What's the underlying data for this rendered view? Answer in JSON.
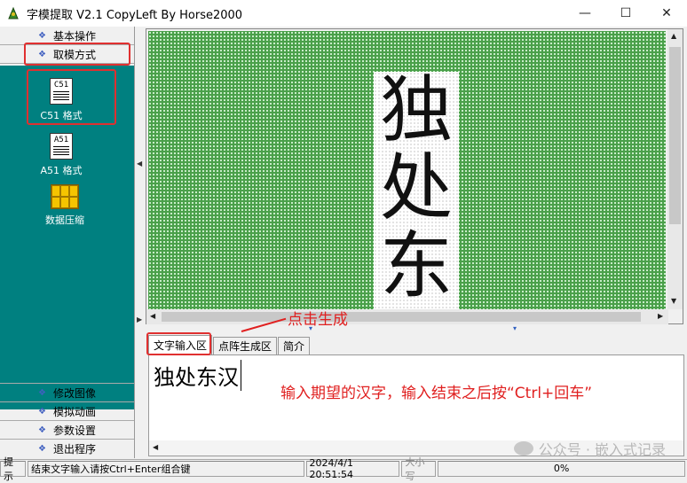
{
  "window": {
    "title": "字模提取 V2.1  CopyLeft By Horse2000",
    "minimize": "—",
    "maximize": "☐",
    "close": "✕"
  },
  "sidebar": {
    "top_items": [
      {
        "label": "基本操作"
      },
      {
        "label": "取模方式"
      }
    ],
    "tools": [
      {
        "icon_text": "C51",
        "label": "C51 格式",
        "icon": "c51-icon"
      },
      {
        "icon_text": "A51",
        "label": "A51 格式",
        "icon": "a51-icon"
      },
      {
        "label": "数据压缩",
        "icon": "compress-icon"
      }
    ],
    "bottom_items": [
      {
        "label": "修改图像"
      },
      {
        "label": "模拟动画"
      },
      {
        "label": "参数设置"
      },
      {
        "label": "退出程序"
      }
    ]
  },
  "canvas": {
    "glyphs": [
      "独",
      "处",
      "东"
    ]
  },
  "tabs": [
    {
      "label": "文字输入区"
    },
    {
      "label": "点阵生成区"
    },
    {
      "label": "简介"
    }
  ],
  "input": {
    "value": "独处东汉"
  },
  "annotations": {
    "click_generate": "点击生成",
    "instruction": "输入期望的汉字，输入结束之后按“Ctrl+回车”"
  },
  "watermark": "公众号 · 嵌入式记录",
  "status": {
    "prompt_label": "提示",
    "message": "结束文字输入请按Ctrl+Enter组合键",
    "datetime": "2024/4/1  20:51:54",
    "case": "大小写",
    "progress": "0%"
  },
  "colors": {
    "grid": "#4aa04a",
    "panel": "#008080",
    "annotation": "#e02020"
  }
}
